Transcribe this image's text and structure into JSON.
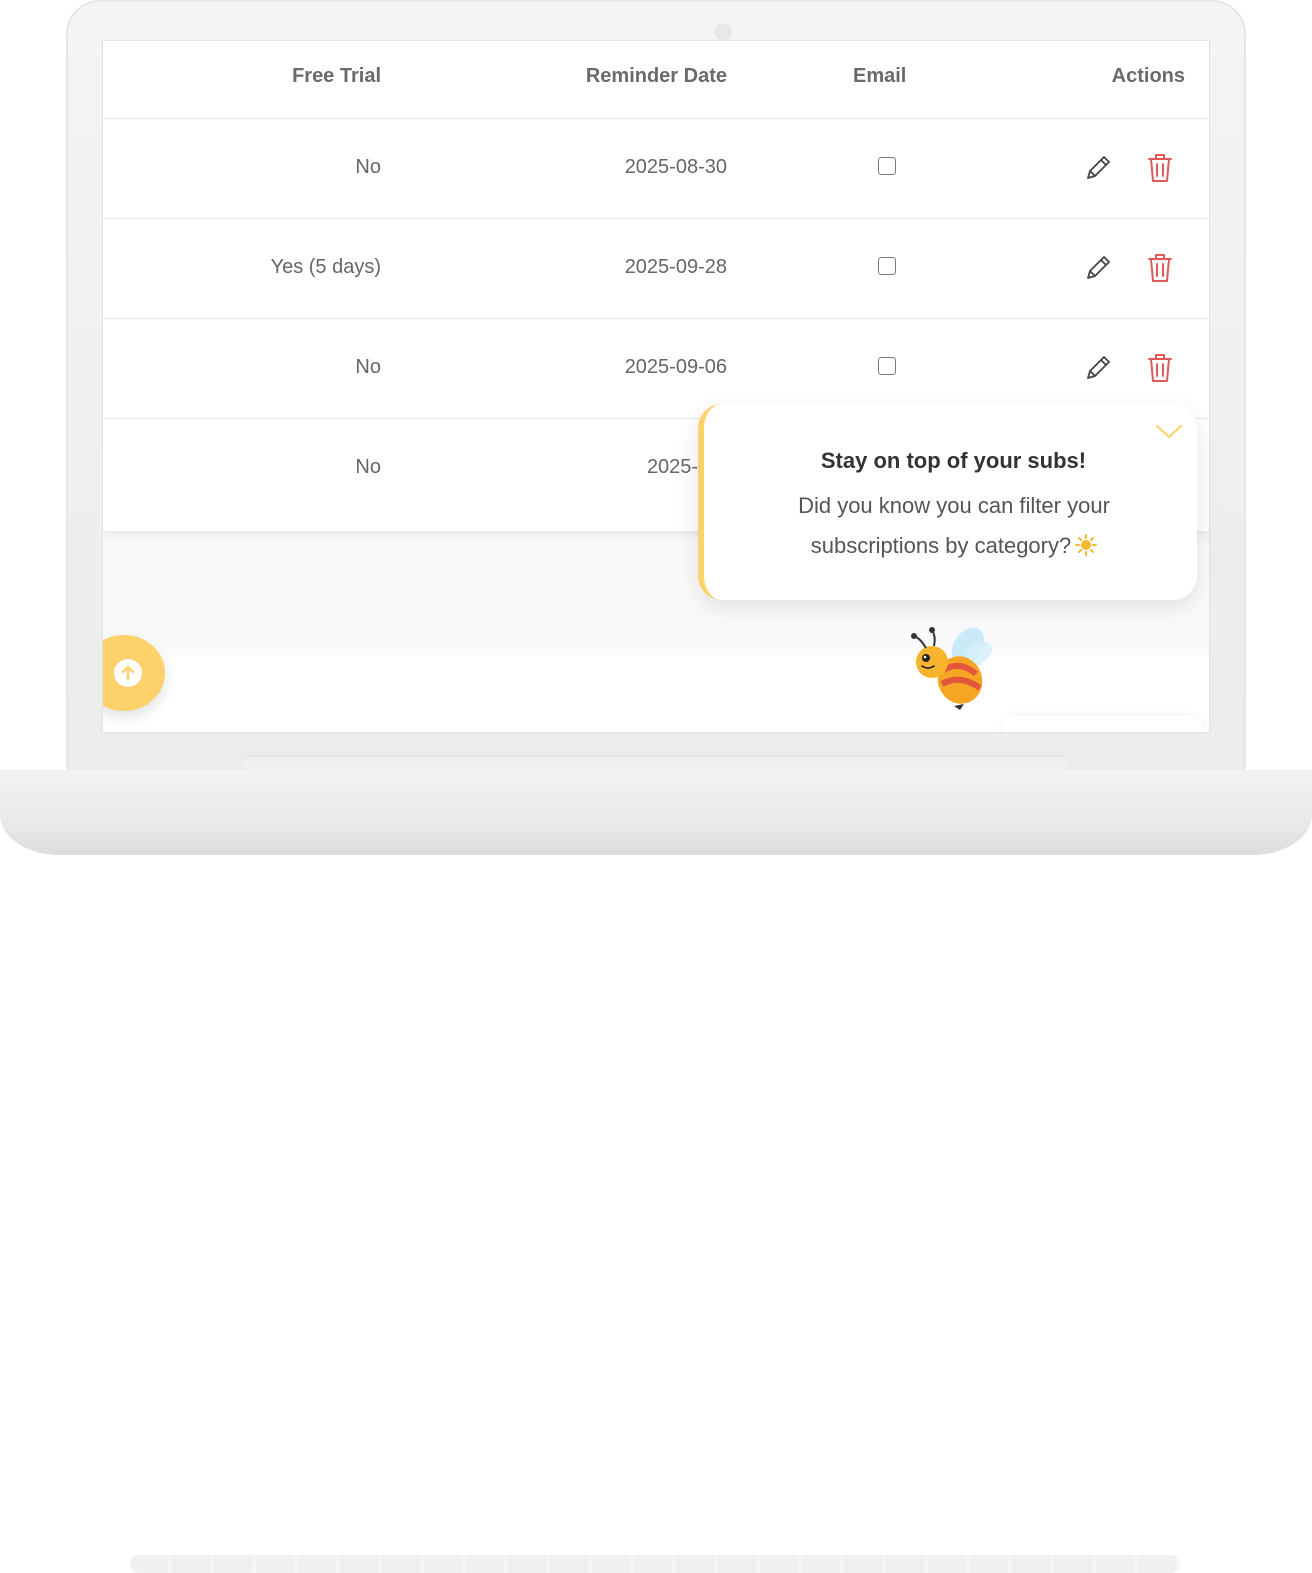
{
  "table": {
    "headers": {
      "free_trial": "Free Trial",
      "reminder_date": "Reminder Date",
      "email": "Email",
      "actions": "Actions"
    },
    "rows": [
      {
        "free_trial": "No",
        "reminder_date": "2025-08-30",
        "email_checked": false
      },
      {
        "free_trial": "Yes (5 days)",
        "reminder_date": "2025-09-28",
        "email_checked": false
      },
      {
        "free_trial": "No",
        "reminder_date": "2025-09-06",
        "email_checked": false
      },
      {
        "free_trial": "No",
        "reminder_date": "2025-09-",
        "email_checked": false
      }
    ]
  },
  "tooltip": {
    "title": "Stay on top of your subs!",
    "body": "Did you know you can filter your subscriptions by category?",
    "emoji": "sun-icon"
  },
  "icons": {
    "edit": "pencil-icon",
    "delete": "trash-icon",
    "scroll_up": "arrow-up-icon",
    "collapse": "chevron-down-icon",
    "mascot": "bee-icon"
  },
  "colors": {
    "accent": "#fdd26a",
    "delete": "#e05a5a",
    "text": "#666666"
  }
}
